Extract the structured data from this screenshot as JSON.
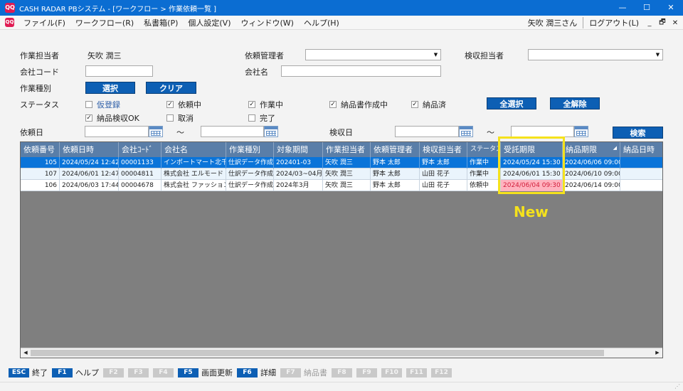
{
  "window": {
    "title": "CASH RADAR PBシステム - [ワークフロー > 作業依頼一覧 ]",
    "icon": "QQ",
    "controls": [
      "—",
      "☐",
      "✕"
    ]
  },
  "menu": {
    "items": [
      "ファイル(F)",
      "ワークフロー(R)",
      "私書箱(P)",
      "個人設定(V)",
      "ウィンドウ(W)",
      "ヘルプ(H)"
    ],
    "user": "矢吹 潤三さん",
    "logout": "ログアウト(L)",
    "mdi_controls": [
      "_",
      "🗗",
      "✕"
    ]
  },
  "filters": {
    "staff_label": "作業担当者",
    "staff_value": "矢吹 潤三",
    "manager_label": "依頼管理者",
    "inspector_label": "検収担当者",
    "company_code_label": "会社コード",
    "company_name_label": "会社名",
    "work_type_label": "作業種別",
    "select_button": "選択",
    "clear_button": "クリア",
    "status_label": "ステータス",
    "statuses": [
      {
        "label": "仮登録",
        "checked": false,
        "link": true
      },
      {
        "label": "依頼中",
        "checked": true
      },
      {
        "label": "作業中",
        "checked": true
      },
      {
        "label": "納品書作成中",
        "checked": true
      },
      {
        "label": "納品済",
        "checked": true
      },
      {
        "label": "納品検収OK",
        "checked": true
      },
      {
        "label": "取消",
        "checked": false
      },
      {
        "label": "完了",
        "checked": false
      }
    ],
    "select_all_button": "全選択",
    "deselect_all_button": "全解除",
    "request_date_label": "依頼日",
    "tilde": "～",
    "inspection_date_label": "検収日",
    "search_button": "検索"
  },
  "grid": {
    "columns": [
      "依頼番号",
      "依頼日時",
      "会社ｺｰﾄﾞ",
      "会社名",
      "作業種別",
      "対象期間",
      "作業担当者",
      "依頼管理者",
      "検収担当者",
      "ステータス",
      "受託期限",
      "納品期限",
      "納品日時"
    ],
    "rows": [
      {
        "no": "105",
        "date": "2024/05/24 12:42",
        "code": "00001133",
        "company": "インポートマート北千住店",
        "type": "仕訳データ作成",
        "period": "202401-03",
        "staff": "矢吹 潤三",
        "manager": "野本 太郎",
        "inspector": "野本 太郎",
        "status": "作業中",
        "accept": "2024/05/24 15:30",
        "delivery": "2024/06/06 09:00",
        "delivered": ""
      },
      {
        "no": "107",
        "date": "2024/06/01 12:47",
        "code": "00004811",
        "company": "株式会社 エルモード",
        "type": "仕訳データ作成",
        "period": "2024/03~04月",
        "staff": "矢吹 潤三",
        "manager": "野本 太郎",
        "inspector": "山田 花子",
        "status": "作業中",
        "accept": "2024/06/01 15:30",
        "delivery": "2024/06/10 09:00",
        "delivered": ""
      },
      {
        "no": "106",
        "date": "2024/06/03 17:44",
        "code": "00004678",
        "company": "株式会社 ファッション中",
        "type": "仕訳データ作成",
        "period": "2024年3月",
        "staff": "矢吹 潤三",
        "manager": "野本 太郎",
        "inspector": "山田 花子",
        "status": "依頼中",
        "accept": "2024/06/04 09:30",
        "delivery": "2024/06/14 09:00",
        "delivered": ""
      }
    ]
  },
  "annotation": {
    "new_label": "New",
    "highlight_color": "#f5e21c"
  },
  "fkeys": [
    {
      "key": "ESC",
      "label": "終了",
      "enabled": true
    },
    {
      "key": "F1",
      "label": "ヘルプ",
      "enabled": true
    },
    {
      "key": "F2",
      "label": "",
      "enabled": false
    },
    {
      "key": "F3",
      "label": "",
      "enabled": false
    },
    {
      "key": "F4",
      "label": "",
      "enabled": false
    },
    {
      "key": "F5",
      "label": "画面更新",
      "enabled": true
    },
    {
      "key": "F6",
      "label": "詳細",
      "enabled": true
    },
    {
      "key": "F7",
      "label": "納品書",
      "enabled": false
    },
    {
      "key": "F8",
      "label": "",
      "enabled": false
    },
    {
      "key": "F9",
      "label": "",
      "enabled": false
    },
    {
      "key": "F10",
      "label": "",
      "enabled": false
    },
    {
      "key": "F11",
      "label": "",
      "enabled": false
    },
    {
      "key": "F12",
      "label": "",
      "enabled": false
    }
  ],
  "colors": {
    "titlebar": "#0b6dd2",
    "button": "#0d5fb4",
    "selected_row": "#0a74d9",
    "grid_header": "#5a7ea8",
    "deadline_warning": "#ffb3bf"
  }
}
